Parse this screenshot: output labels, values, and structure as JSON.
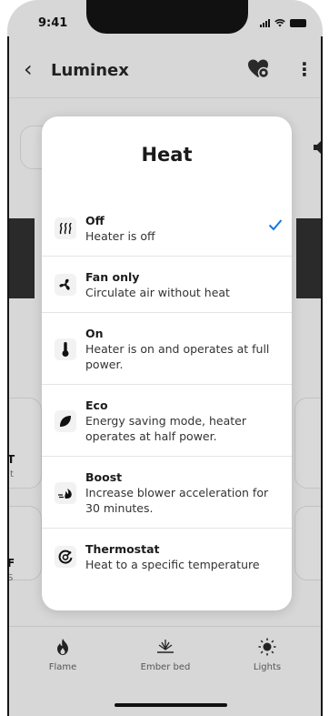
{
  "status_bar": {
    "time": "9:41"
  },
  "header": {
    "title": "Luminex"
  },
  "modal": {
    "title": "Heat",
    "options": [
      {
        "title": "Off",
        "description": "Heater is off",
        "icon": "heat-waves-icon",
        "selected": true
      },
      {
        "title": "Fan only",
        "description": "Circulate air without heat",
        "icon": "fan-icon",
        "selected": false
      },
      {
        "title": "On",
        "description": "Heater is on and operates at full power.",
        "icon": "thermometer-icon",
        "selected": false
      },
      {
        "title": "Eco",
        "description": "Energy saving mode, heater operates at half power.",
        "icon": "leaf-icon",
        "selected": false
      },
      {
        "title": "Boost",
        "description": "Increase blower acceleration for 30 minutes.",
        "icon": "boost-wind-icon",
        "selected": false
      },
      {
        "title": "Thermostat",
        "description": "Heat to a specific temperature",
        "icon": "thermostat-dial-icon",
        "selected": false
      }
    ]
  },
  "background": {
    "row1_letter": "T",
    "row1_sub": "It",
    "row2_letter": "F",
    "row2_sub": "S"
  },
  "tabbar": {
    "tabs": [
      {
        "label": "Flame",
        "icon": "flame-icon"
      },
      {
        "label": "Ember bed",
        "icon": "ember-bed-icon"
      },
      {
        "label": "Lights",
        "icon": "sun-icon"
      }
    ]
  },
  "colors": {
    "accent": "#1a73e8",
    "dim_background": "#d7d7d7",
    "modal": "#ffffff"
  }
}
